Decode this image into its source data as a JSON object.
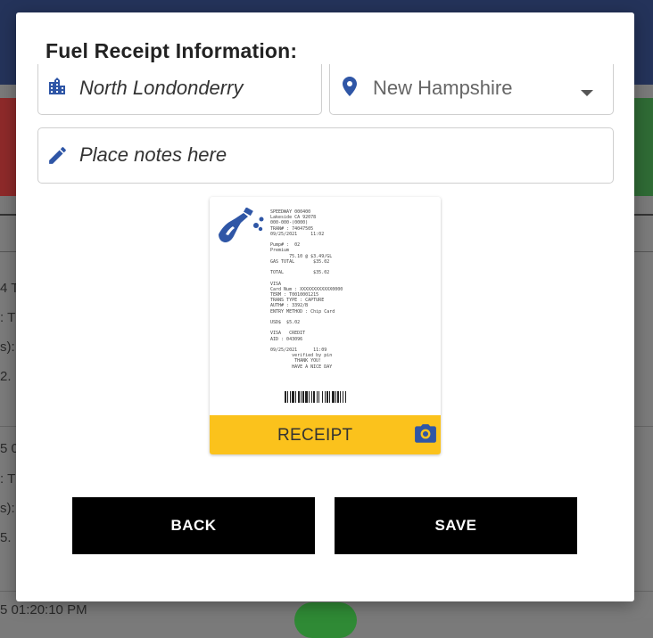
{
  "background": {
    "left_texts": [
      "4 T",
      ": T",
      "s):",
      "2.",
      "5 0",
      ": T",
      "s):",
      "5.",
      "5 01:20:10 PM"
    ]
  },
  "dialog": {
    "title": "Fuel Receipt Information:",
    "city": {
      "value": "North Londonderry",
      "icon": "city-icon"
    },
    "state": {
      "value": "New Hampshire",
      "icon": "location-pin-icon",
      "dropdown_icon": "caret-down-icon"
    },
    "notes": {
      "placeholder": "Place notes here",
      "icon": "pencil-icon"
    },
    "receipt": {
      "label": "RECEIPT",
      "camera_icon": "camera-icon",
      "pump_icon": "fuel-pump-icon",
      "lines": [
        "SPEEDWAY 000400",
        "Lakeside CA 92078",
        "000-000-(0000)",
        "TRAN# : 74047505",
        "09/25/2021     11:02",
        "",
        "Pump# :  02",
        "Premium",
        "       75.10 @ $3.49/GL",
        "GAS TOTAL       $35.02",
        "",
        "TOTAL           $35.02",
        "",
        "VISA",
        "Card Num : XXXXXXXXXXXX0000",
        "TERM : T0010001215",
        "TRANS TYPE : CAPTURE",
        "AUTH# : 3392/B",
        "ENTRY METHOD : Chip Card",
        "",
        "USD$  $5.02",
        "",
        "VISA   CREDIT",
        "AID : 043096",
        "",
        "09/25/2021      11:09",
        "        verified by pin",
        "         THANK YOU!",
        "        HAVE A NICE DAY"
      ]
    },
    "buttons": {
      "back": "BACK",
      "save": "SAVE"
    }
  },
  "colors": {
    "accent_blue": "#2f56a6",
    "receipt_yellow": "#fbc21c",
    "button_black": "#000000"
  }
}
